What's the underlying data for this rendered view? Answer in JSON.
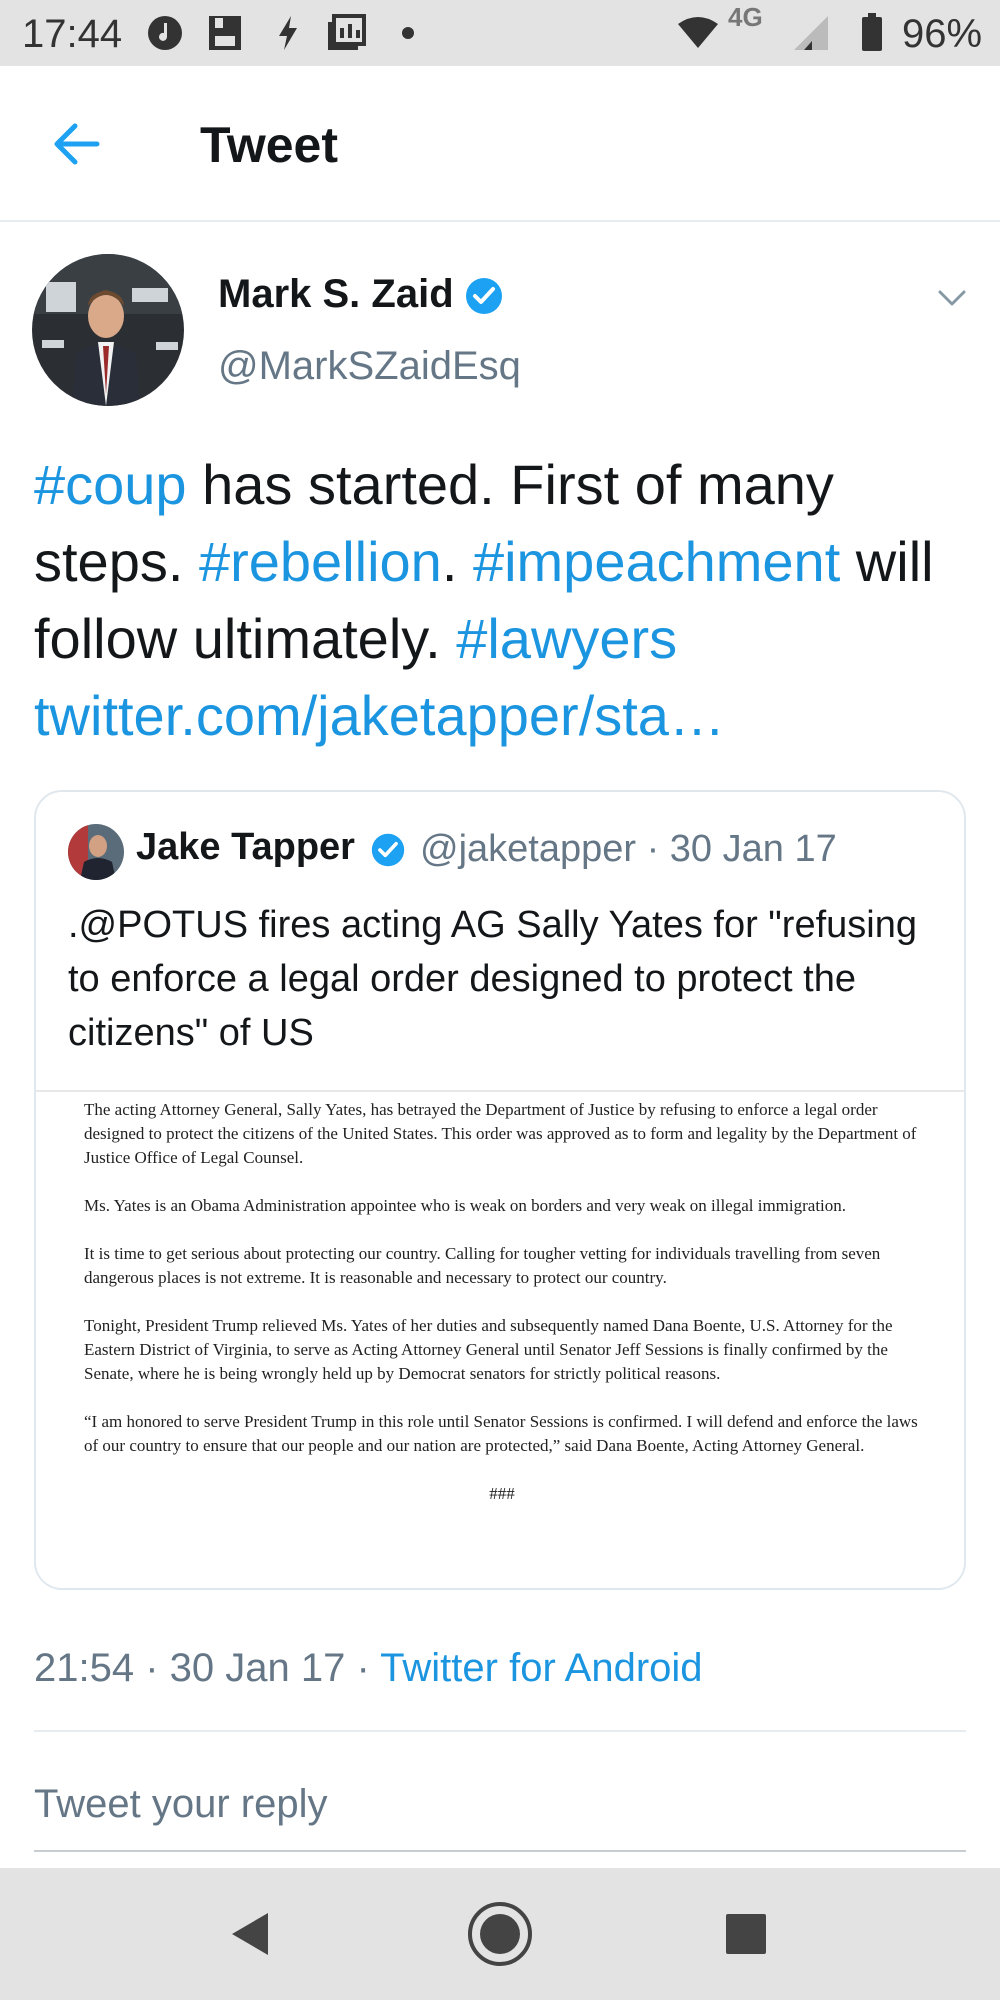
{
  "status_bar": {
    "time": "17:44",
    "network": "4G",
    "battery": "96%",
    "icons": [
      "notification-icon",
      "save-icon",
      "bolt-icon",
      "gallery-icon",
      "dot-icon",
      "wifi-icon",
      "signal-icon",
      "battery-icon"
    ]
  },
  "app_bar": {
    "title": "Tweet",
    "back_icon": "arrow-left-icon"
  },
  "tweet": {
    "author_name": "Mark S. Zaid",
    "author_handle": "@MarkSZaidEsq",
    "text_parts": {
      "p1": "#coup",
      "p2": " has started. First of many steps. ",
      "p3": "#rebellion",
      "p4": ". ",
      "p5": "#impeachment",
      "p6": " will follow ultimately. ",
      "p7": "#lawyers",
      "p8": " ",
      "p9": "twitter.com/jaketapper/sta…"
    },
    "quoted": {
      "name": "Jake Tapper",
      "meta": "@jaketapper · 30 Jan 17",
      "text": ".@POTUS fires acting AG Sally Yates  for \"refusing to enforce a legal order designed to protect the citizens\" of US",
      "document": {
        "para1": "The acting Attorney General, Sally Yates, has betrayed the Department of Justice by refusing to enforce a legal order designed to protect the citizens of the United States. This order was approved as to form and legality by the Department of Justice Office of Legal Counsel.",
        "para2": "Ms. Yates is an Obama Administration appointee who is weak on borders and very weak on illegal immigration.",
        "para3": "It is time to get serious about protecting our country. Calling for tougher vetting for individuals travelling from seven dangerous places is not extreme. It is reasonable and necessary to protect our country.",
        "para4": "Tonight, President Trump relieved Ms. Yates of her duties and subsequently named Dana Boente, U.S. Attorney for the Eastern District of Virginia, to serve as Acting Attorney General until Senator Jeff Sessions is finally confirmed by the Senate, where he is being wrongly held up by Democrat senators for strictly political reasons.",
        "para5": "“I am honored to serve President Trump in this role until Senator Sessions is confirmed. I will defend and enforce the laws of our country to ensure that our people and our nation are protected,” said Dana Boente, Acting Attorney General.",
        "end": "###"
      }
    },
    "timestamp": "21:54 · 30 Jan 17 · ",
    "source": "Twitter for Android"
  },
  "reply": {
    "placeholder": "Tweet your reply"
  },
  "nav_bar": {
    "icons": [
      "back-triangle-icon",
      "home-circle-icon",
      "recents-square-icon"
    ]
  },
  "colors": {
    "link": "#1b95e0",
    "muted": "#657786",
    "text": "#14171a",
    "system_bar": "#e3e3e3"
  }
}
